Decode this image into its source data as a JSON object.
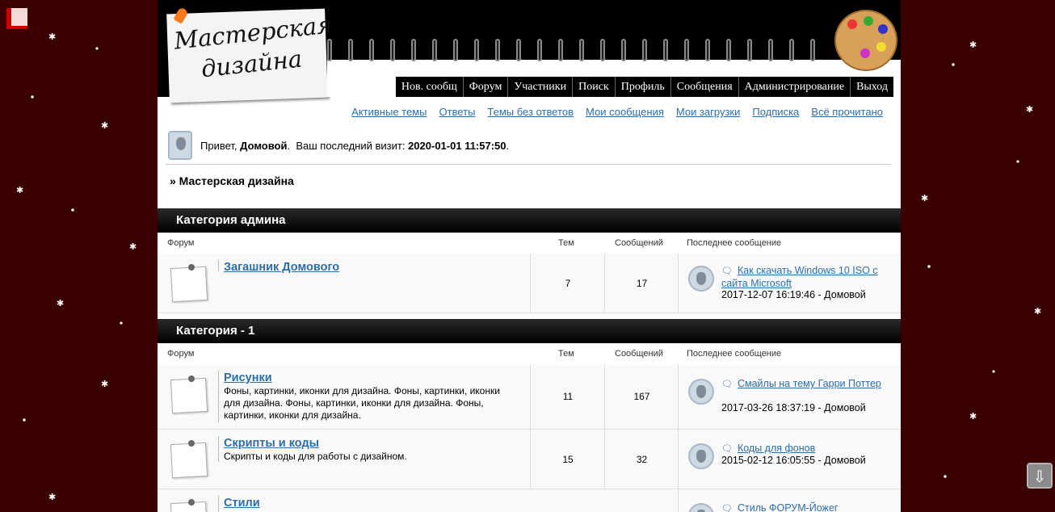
{
  "logo_text": "Мастерская дизайна",
  "nav": [
    "Нов. сообщ",
    "Форум",
    "Участники",
    "Поиск",
    "Профиль",
    "Сообщения",
    "Администрирование",
    "Выход"
  ],
  "sublinks": [
    "Активные темы",
    "Ответы",
    "Темы без ответов",
    "Мои сообщения",
    "Мои загрузки",
    "Подписка",
    "Всё прочитано"
  ],
  "greeting": {
    "hello": "Привет,",
    "user": "Домовой",
    "visit_label": "Ваш последний визит:",
    "visit_time": "2020-01-01 11:57:50"
  },
  "breadcrumb": "» Мастерская дизайна",
  "columns": {
    "forum": "Форум",
    "topics": "Тем",
    "posts": "Сообщений",
    "last": "Последнее сообщение"
  },
  "categories": [
    {
      "title": "Категория админа",
      "forums": [
        {
          "name": "Загашник Домового",
          "desc": "",
          "topics": "7",
          "posts": "17",
          "last_topic": "Как скачать Windows 10 ISO с сайта Microsoft",
          "last_meta": "2017-12-07 16:19:46 - Домовой"
        }
      ]
    },
    {
      "title": "Категория - 1",
      "forums": [
        {
          "name": "Рисунки",
          "desc": "Фоны, картинки, иконки для дизайна. Фоны, картинки, иконки для дизайна. Фоны, картинки, иконки для дизайна. Фоны, картинки, иконки для дизайна.",
          "topics": "11",
          "posts": "167",
          "last_topic": "Смайлы на тему Гарри Поттер",
          "last_meta": "2017-03-26 18:37:19 - Домовой"
        },
        {
          "name": "Скрипты и коды",
          "desc": "Скрипты и коды для работы с дизайном.",
          "topics": "15",
          "posts": "32",
          "last_topic": "Коды для фонов",
          "last_meta": "2015-02-12 16:05:55 - Домовой"
        },
        {
          "name": "Стили",
          "desc": "",
          "topics": "",
          "posts": "",
          "last_topic": "Стиль ФОРУМ-Йожег",
          "last_meta": ""
        }
      ]
    }
  ]
}
